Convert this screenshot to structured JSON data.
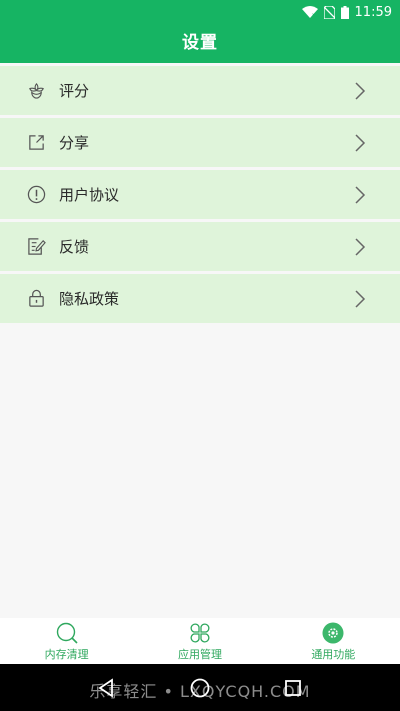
{
  "status_bar": {
    "time": "11:59"
  },
  "header": {
    "title": "设置"
  },
  "menu": {
    "items": [
      {
        "key": "rate",
        "label": "评分",
        "icon": "flower-icon"
      },
      {
        "key": "share",
        "label": "分享",
        "icon": "share-icon"
      },
      {
        "key": "agreement",
        "label": "用户协议",
        "icon": "info-icon"
      },
      {
        "key": "feedback",
        "label": "反馈",
        "icon": "edit-icon"
      },
      {
        "key": "privacy",
        "label": "隐私政策",
        "icon": "lock-icon"
      }
    ]
  },
  "tabbar": {
    "tabs": [
      {
        "label": "内存清理",
        "icon": "magnifier-icon"
      },
      {
        "label": "应用管理",
        "icon": "clover-icon"
      },
      {
        "label": "通用功能",
        "icon": "gear-icon"
      }
    ]
  },
  "watermark": "乐享轻汇 • LXQYCQH.COM",
  "colors": {
    "header": "#16b463",
    "row": "#dff4da",
    "accent": "#2fa85e"
  }
}
